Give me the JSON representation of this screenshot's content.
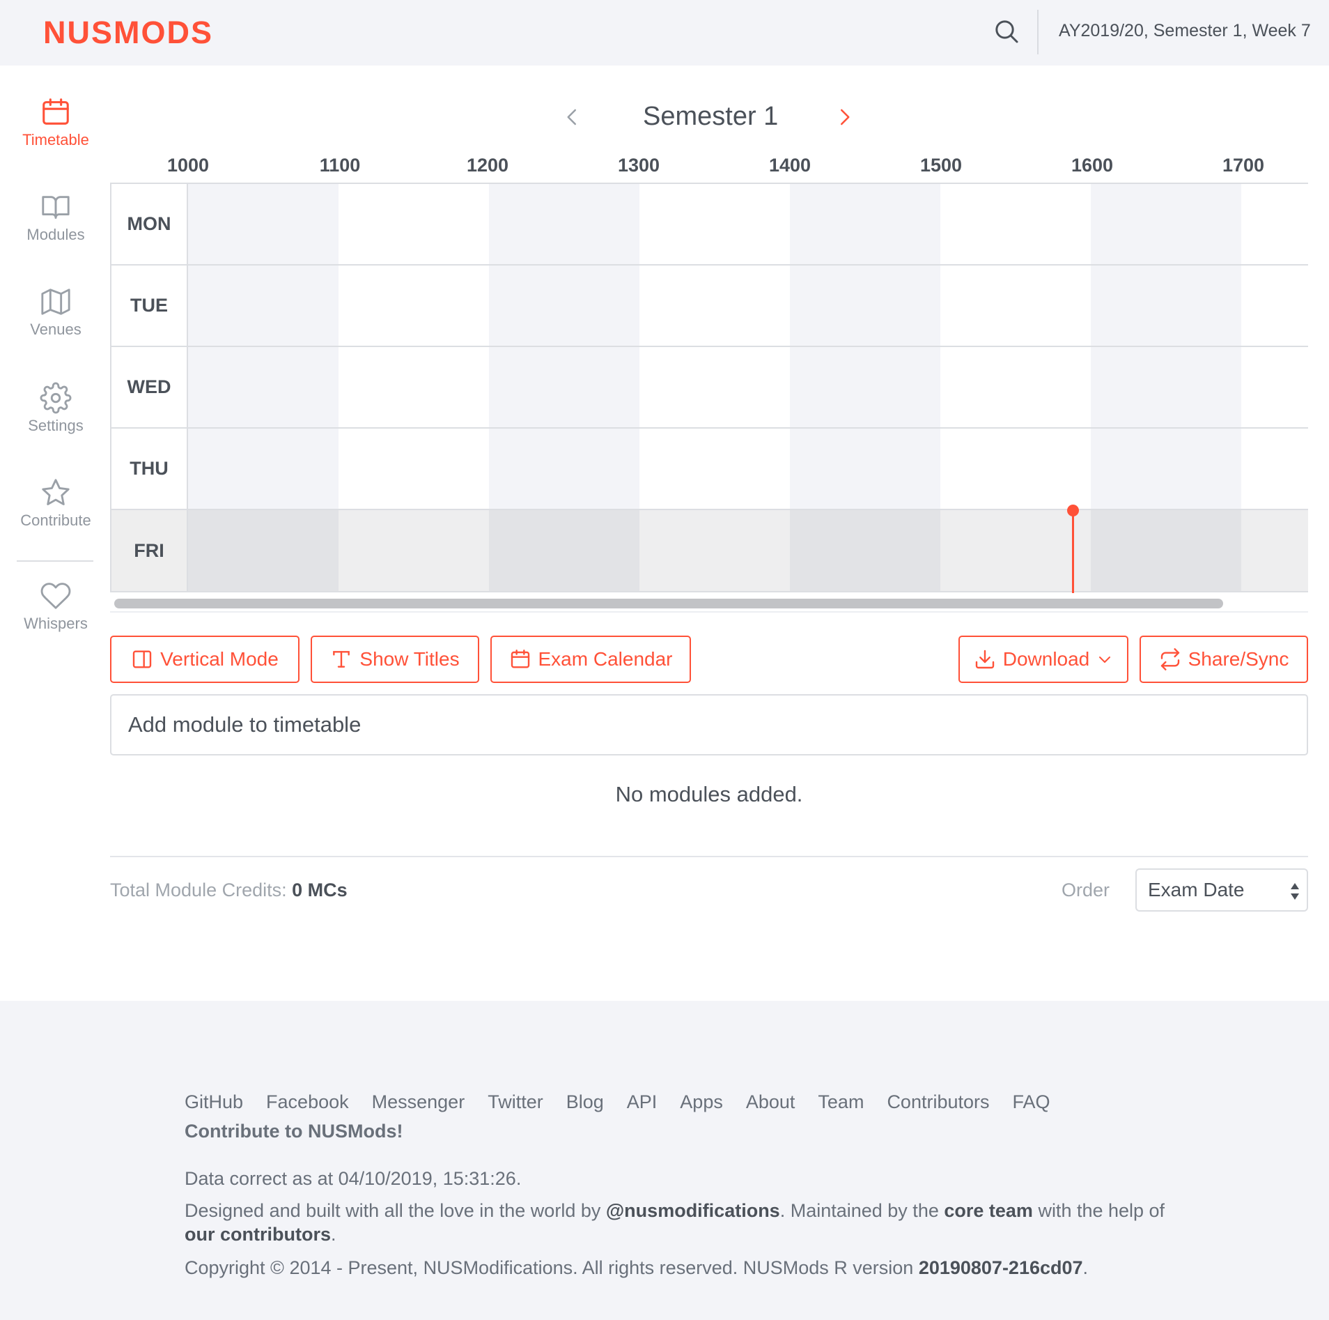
{
  "header": {
    "brand": "NUSMODS",
    "week": "AY2019/20, Semester 1, Week 7"
  },
  "sidebar": {
    "items": [
      {
        "label": "Timetable",
        "icon": "calendar-icon",
        "active": true
      },
      {
        "label": "Modules",
        "icon": "book-icon"
      },
      {
        "label": "Venues",
        "icon": "map-icon"
      },
      {
        "label": "Settings",
        "icon": "gear-icon"
      },
      {
        "label": "Contribute",
        "icon": "star-icon"
      },
      {
        "label": "Whispers",
        "icon": "heart-icon"
      }
    ]
  },
  "semester": {
    "title": "Semester 1"
  },
  "timetable": {
    "hours": [
      "1000",
      "1100",
      "1200",
      "1300",
      "1400",
      "1500",
      "1600",
      "1700"
    ],
    "days": [
      "MON",
      "TUE",
      "WED",
      "THU",
      "FRI"
    ],
    "today": "FRI"
  },
  "actions": {
    "vertical_mode": "Vertical Mode",
    "show_titles": "Show Titles",
    "exam_calendar": "Exam Calendar",
    "download": "Download",
    "share_sync": "Share/Sync"
  },
  "module_search": {
    "placeholder": "Add module to timetable"
  },
  "modules": {
    "empty_message": "No modules added."
  },
  "summary": {
    "credits_label": "Total Module Credits:",
    "credits_value": "0 MCs",
    "order_label": "Order",
    "order_value": "Exam Date"
  },
  "footer": {
    "links": [
      "GitHub",
      "Facebook",
      "Messenger",
      "Twitter",
      "Blog",
      "API",
      "Apps",
      "About",
      "Team",
      "Contributors",
      "FAQ"
    ],
    "contribute": "Contribute to NUSMods!",
    "data_correct": "Data correct as at 04/10/2019, 15:31:26.",
    "designed_prefix": "Designed and built with all the love in the world by ",
    "designed_handle": "@nusmodifications",
    "designed_mid": ". Maintained by the ",
    "designed_team": "core team",
    "designed_with": " with the help of ",
    "designed_contrib": "our contributors",
    "designed_end": ".",
    "copyright_prefix": "Copyright © 2014 - Present, NUSModifications. All rights reserved. NUSMods R version ",
    "version": "20190807-216cd07",
    "copyright_end": "."
  },
  "colors": {
    "accent": "#ff5138",
    "text": "#4b5159",
    "muted": "#69707a",
    "border": "#dcdee2",
    "shade": "#f3f4f8"
  }
}
